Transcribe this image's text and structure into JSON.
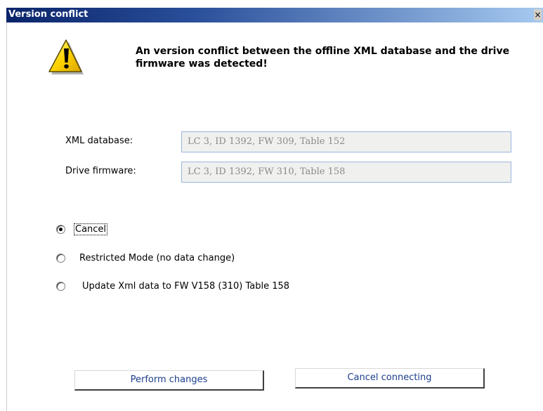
{
  "window": {
    "title": "Version conflict",
    "close_glyph": "×"
  },
  "message": {
    "icon": "warning-icon",
    "text": "An version conflict between the offline XML database and the drive firmware was detected!"
  },
  "fields": {
    "xml_database": {
      "label": "XML database:",
      "value": "LC 3, ID 1392, FW 309, Table 152"
    },
    "drive_firmware": {
      "label": "Drive firmware:",
      "value": "LC 3, ID 1392, FW 310, Table 158"
    }
  },
  "options": [
    {
      "label": "Cancel",
      "selected": true
    },
    {
      "label": "Restricted Mode (no data change)",
      "selected": false
    },
    {
      "label": "Update Xml data to FW V158 (310) Table 158",
      "selected": false
    }
  ],
  "buttons": {
    "perform": "Perform changes",
    "cancel_connecting": "Cancel connecting"
  },
  "colors": {
    "title_bar_start": "#0a246a",
    "title_bar_end": "#a6caf0",
    "warning_fill": "#ffd400",
    "button_text": "#1a3d8a"
  }
}
